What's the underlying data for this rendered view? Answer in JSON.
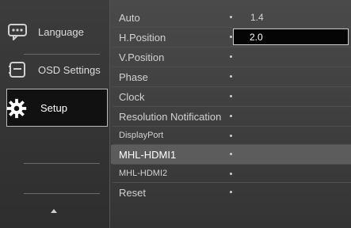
{
  "nav": {
    "items": [
      {
        "label": "Language",
        "icon": "language-icon"
      },
      {
        "label": "OSD Settings",
        "icon": "osd-settings-icon"
      },
      {
        "label": "Setup",
        "icon": "setup-gear-icon",
        "selected": true
      }
    ]
  },
  "menu": {
    "items": [
      {
        "label": "Auto",
        "value": "1.4"
      },
      {
        "label": "H.Position",
        "value": "2.0",
        "editing": true
      },
      {
        "label": "V.Position",
        "value": ""
      },
      {
        "label": "Phase",
        "value": ""
      },
      {
        "label": "Clock",
        "value": ""
      },
      {
        "label": "Resolution Notification",
        "value": ""
      },
      {
        "label": "DisplayPort",
        "value": ""
      },
      {
        "label": "MHL-HDMI1",
        "value": ""
      },
      {
        "label": "MHL-HDMI2",
        "value": ""
      },
      {
        "label": "Reset",
        "value": ""
      }
    ]
  }
}
